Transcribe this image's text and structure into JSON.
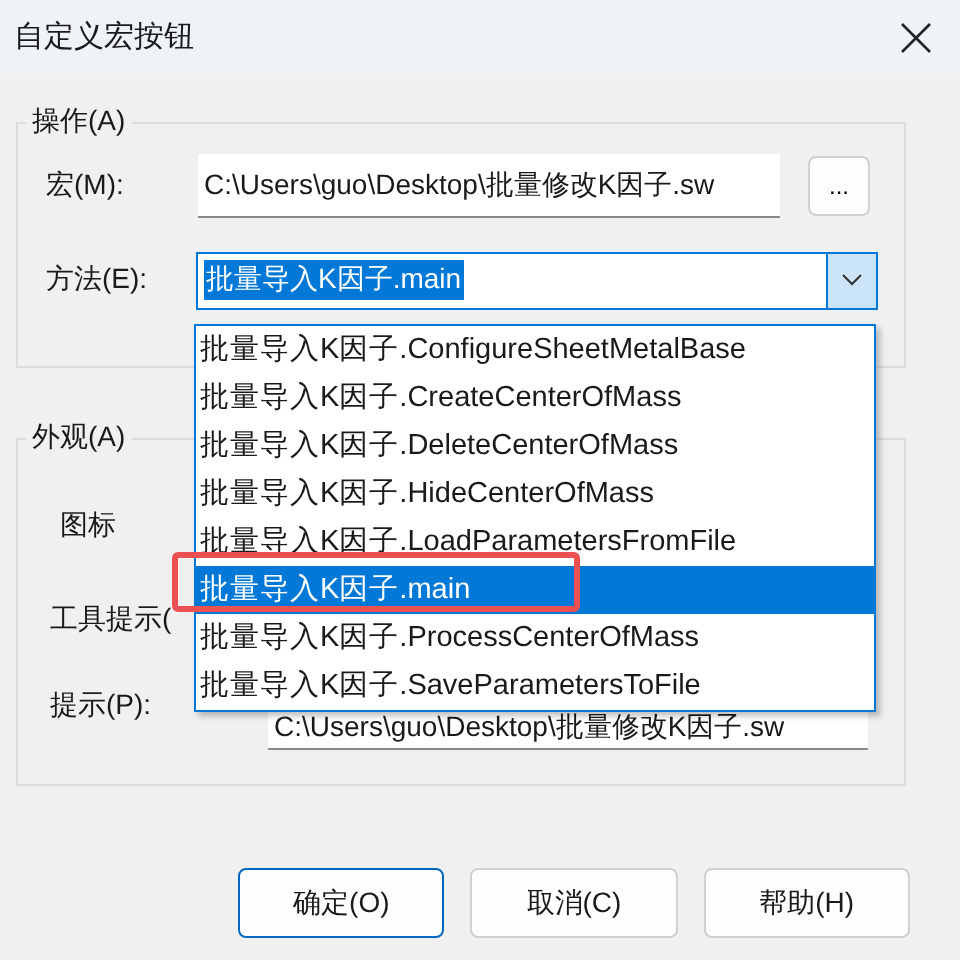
{
  "window": {
    "title": "自定义宏按钮"
  },
  "action_group": {
    "legend": "操作(A)",
    "macro": {
      "label": "宏(M):",
      "value": "C:\\Users\\guo\\Desktop\\批量修改K因子.sw",
      "browse": "..."
    },
    "method": {
      "label": "方法(E):",
      "value": "批量导入K因子.main",
      "expanded": true,
      "options": [
        {
          "label": "批量导入K因子.ConfigureSheetMetalBase",
          "selected": false,
          "annotated": false
        },
        {
          "label": "批量导入K因子.CreateCenterOfMass",
          "selected": false,
          "annotated": false
        },
        {
          "label": "批量导入K因子.DeleteCenterOfMass",
          "selected": false,
          "annotated": false
        },
        {
          "label": "批量导入K因子.HideCenterOfMass",
          "selected": false,
          "annotated": false
        },
        {
          "label": "批量导入K因子.LoadParametersFromFile",
          "selected": false,
          "annotated": false
        },
        {
          "label": "批量导入K因子.main",
          "selected": true,
          "annotated": true
        },
        {
          "label": "批量导入K因子.ProcessCenterOfMass",
          "selected": false,
          "annotated": false
        },
        {
          "label": "批量导入K因子.SaveParametersToFile",
          "selected": false,
          "annotated": false
        }
      ]
    }
  },
  "appearance_group": {
    "legend": "外观(A)",
    "icon_label": "图标",
    "tooltip_label": "工具提示(",
    "prompt": {
      "label": "提示(P):",
      "value": "C:\\Users\\guo\\Desktop\\批量修改K因子.sw"
    }
  },
  "buttons": [
    {
      "label": "确定(O)",
      "default": true
    },
    {
      "label": "取消(C)",
      "default": false
    },
    {
      "label": "帮助(H)",
      "default": false
    }
  ]
}
